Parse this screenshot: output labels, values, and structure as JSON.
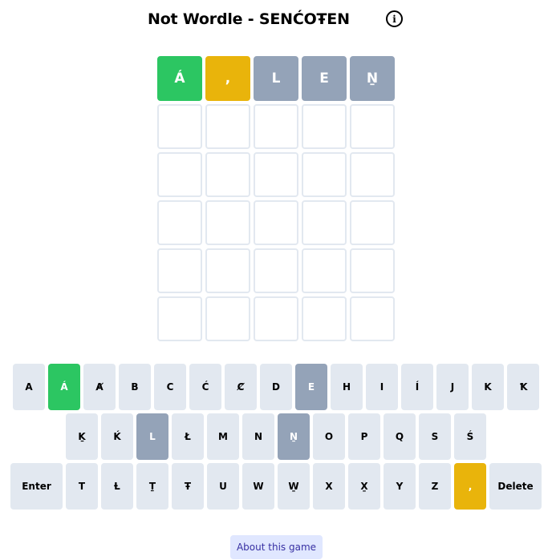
{
  "header": {
    "title": "Not Wordle - SENĆOŦEN",
    "info_icon": "info-icon",
    "info_glyph": "i"
  },
  "board": {
    "rows": [
      [
        {
          "letter": "Á",
          "state": "correct"
        },
        {
          "letter": ",",
          "state": "present"
        },
        {
          "letter": "L",
          "state": "absent"
        },
        {
          "letter": "E",
          "state": "absent"
        },
        {
          "letter": "Ṉ",
          "state": "absent"
        }
      ],
      [
        {
          "letter": "",
          "state": "empty"
        },
        {
          "letter": "",
          "state": "empty"
        },
        {
          "letter": "",
          "state": "empty"
        },
        {
          "letter": "",
          "state": "empty"
        },
        {
          "letter": "",
          "state": "empty"
        }
      ],
      [
        {
          "letter": "",
          "state": "empty"
        },
        {
          "letter": "",
          "state": "empty"
        },
        {
          "letter": "",
          "state": "empty"
        },
        {
          "letter": "",
          "state": "empty"
        },
        {
          "letter": "",
          "state": "empty"
        }
      ],
      [
        {
          "letter": "",
          "state": "empty"
        },
        {
          "letter": "",
          "state": "empty"
        },
        {
          "letter": "",
          "state": "empty"
        },
        {
          "letter": "",
          "state": "empty"
        },
        {
          "letter": "",
          "state": "empty"
        }
      ],
      [
        {
          "letter": "",
          "state": "empty"
        },
        {
          "letter": "",
          "state": "empty"
        },
        {
          "letter": "",
          "state": "empty"
        },
        {
          "letter": "",
          "state": "empty"
        },
        {
          "letter": "",
          "state": "empty"
        }
      ],
      [
        {
          "letter": "",
          "state": "empty"
        },
        {
          "letter": "",
          "state": "empty"
        },
        {
          "letter": "",
          "state": "empty"
        },
        {
          "letter": "",
          "state": "empty"
        },
        {
          "letter": "",
          "state": "empty"
        }
      ]
    ]
  },
  "keyboard": {
    "rows": [
      [
        {
          "label": "A",
          "state": ""
        },
        {
          "label": "Á",
          "state": "correct"
        },
        {
          "label": "Ⱥ",
          "state": ""
        },
        {
          "label": "B",
          "state": ""
        },
        {
          "label": "C",
          "state": ""
        },
        {
          "label": "Ć",
          "state": ""
        },
        {
          "label": "Ȼ",
          "state": ""
        },
        {
          "label": "D",
          "state": ""
        },
        {
          "label": "E",
          "state": "absent"
        },
        {
          "label": "H",
          "state": ""
        },
        {
          "label": "I",
          "state": ""
        },
        {
          "label": "Í",
          "state": ""
        },
        {
          "label": "J",
          "state": ""
        },
        {
          "label": "K",
          "state": ""
        },
        {
          "label": "Ꝁ",
          "state": ""
        }
      ],
      [
        {
          "label": "Ḵ",
          "state": ""
        },
        {
          "label": "Ḱ",
          "state": ""
        },
        {
          "label": "L",
          "state": "absent"
        },
        {
          "label": "Ł",
          "state": ""
        },
        {
          "label": "M",
          "state": ""
        },
        {
          "label": "N",
          "state": ""
        },
        {
          "label": "Ṉ",
          "state": "absent"
        },
        {
          "label": "O",
          "state": ""
        },
        {
          "label": "P",
          "state": ""
        },
        {
          "label": "Q",
          "state": ""
        },
        {
          "label": "S",
          "state": ""
        },
        {
          "label": "Ś",
          "state": ""
        }
      ],
      [
        {
          "label": "Enter",
          "state": "",
          "wide": true
        },
        {
          "label": "T",
          "state": ""
        },
        {
          "label": "Ƚ",
          "state": ""
        },
        {
          "label": "Ṯ",
          "state": ""
        },
        {
          "label": "Ŧ",
          "state": ""
        },
        {
          "label": "U",
          "state": ""
        },
        {
          "label": "W",
          "state": ""
        },
        {
          "label": "W̱",
          "state": ""
        },
        {
          "label": "X",
          "state": ""
        },
        {
          "label": "X̱",
          "state": ""
        },
        {
          "label": "Y",
          "state": ""
        },
        {
          "label": "Z",
          "state": ""
        },
        {
          "label": ",",
          "state": "present"
        },
        {
          "label": "Delete",
          "state": "",
          "wide": true
        }
      ]
    ]
  },
  "footer": {
    "about_label": "About this game"
  },
  "colors": {
    "correct": "#2cc662",
    "present": "#e9b40b",
    "absent": "#94a3b8",
    "key_default": "#e2e8f0",
    "about_bg": "#e0e7ff",
    "about_text": "#3730a3"
  }
}
